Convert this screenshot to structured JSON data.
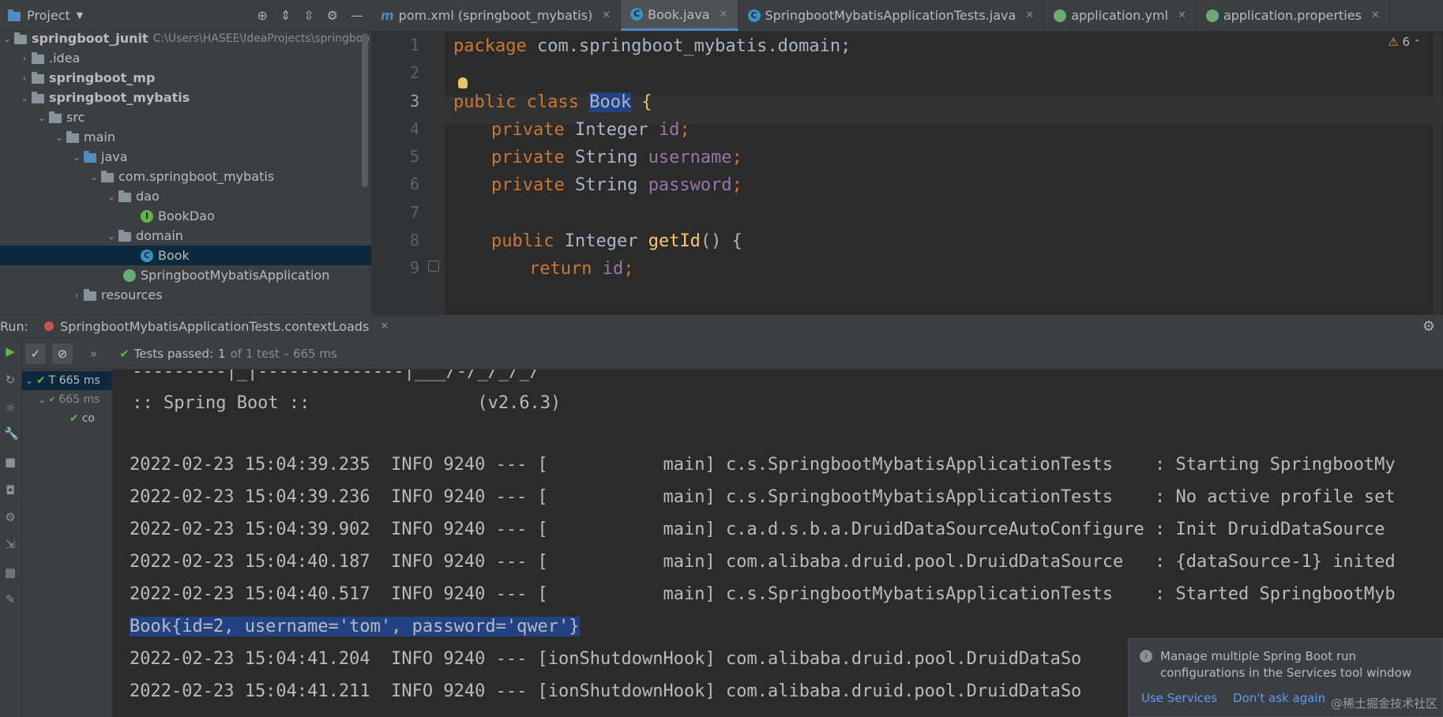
{
  "project": {
    "title": "Project",
    "tree": [
      {
        "label": "springboot_junit",
        "path": "C:\\Users\\HASEE\\IdeaProjects\\springboo",
        "bold": true
      },
      {
        "label": ".idea"
      },
      {
        "label": "springboot_mp",
        "bold": true
      },
      {
        "label": "springboot_mybatis",
        "bold": true
      },
      {
        "label": "src"
      },
      {
        "label": "main"
      },
      {
        "label": "java"
      },
      {
        "label": "com.springboot_mybatis"
      },
      {
        "label": "dao"
      },
      {
        "label": "BookDao"
      },
      {
        "label": "domain"
      },
      {
        "label": "Book"
      },
      {
        "label": "SpringbootMybatisApplication"
      },
      {
        "label": "resources"
      }
    ]
  },
  "tabs": [
    {
      "label": "pom.xml (springboot_mybatis)"
    },
    {
      "label": "Book.java",
      "active": true
    },
    {
      "label": "SpringbootMybatisApplicationTests.java"
    },
    {
      "label": "application.yml"
    },
    {
      "label": "application.properties"
    }
  ],
  "editor": {
    "warnings": "6",
    "line_numbers": [
      "1",
      "2",
      "3",
      "4",
      "5",
      "6",
      "7",
      "8",
      "9"
    ],
    "lines": {
      "l1": {
        "kw": "package",
        "rest": " com.springboot_mybatis.domain;"
      },
      "l3": {
        "kw": "public class",
        "cls": "Book",
        "rest": " {"
      },
      "l4": {
        "kw": "private",
        "type": " Integer ",
        "field": "id",
        "end": ";"
      },
      "l5": {
        "kw": "private",
        "type": " String ",
        "field": "username",
        "end": ";"
      },
      "l6": {
        "kw": "private",
        "type": " String ",
        "field": "password",
        "end": ";"
      },
      "l8": {
        "kw": "public",
        "type": " Integer ",
        "method": "getId",
        "end": "() {"
      },
      "l9": {
        "kw": "return",
        "field": " id",
        "end": ";"
      }
    }
  },
  "run": {
    "label": "Run:",
    "tab": "SpringbootMybatisApplicationTests.contextLoads",
    "status_prefix": "Tests passed:",
    "status_count": "1",
    "status_rest": "of 1 test – 665 ms",
    "test_tree": [
      {
        "label": "T 665 ms"
      },
      {
        "label": "665 ms"
      },
      {
        "label": "co"
      }
    ]
  },
  "console": {
    "lines": [
      " ---------|_|--------------|___/-/_/_/_/",
      " :: Spring Boot ::                (v2.6.3)",
      "",
      "2022-02-23 15:04:39.235  INFO 9240 --- [           main] c.s.SpringbootMybatisApplicationTests    : Starting SpringbootMy",
      "2022-02-23 15:04:39.236  INFO 9240 --- [           main] c.s.SpringbootMybatisApplicationTests    : No active profile set",
      "2022-02-23 15:04:39.902  INFO 9240 --- [           main] c.a.d.s.b.a.DruidDataSourceAutoConfigure : Init DruidDataSource",
      "2022-02-23 15:04:40.187  INFO 9240 --- [           main] com.alibaba.druid.pool.DruidDataSource   : {dataSource-1} inited",
      "2022-02-23 15:04:40.517  INFO 9240 --- [           main] c.s.SpringbootMybatisApplicationTests    : Started SpringbootMyb",
      "Book{id=2, username='tom', password='qwer'}",
      "2022-02-23 15:04:41.204  INFO 9240 --- [ionShutdownHook] com.alibaba.druid.pool.DruidDataSo",
      "2022-02-23 15:04:41.211  INFO 9240 --- [ionShutdownHook] com.alibaba.druid.pool.DruidDataSo"
    ]
  },
  "notification": {
    "message": "Manage multiple Spring Boot run configurations in the Services tool window",
    "action1": "Use Services",
    "action2": "Don't ask again"
  },
  "watermark": "@稀土掘金技术社区"
}
